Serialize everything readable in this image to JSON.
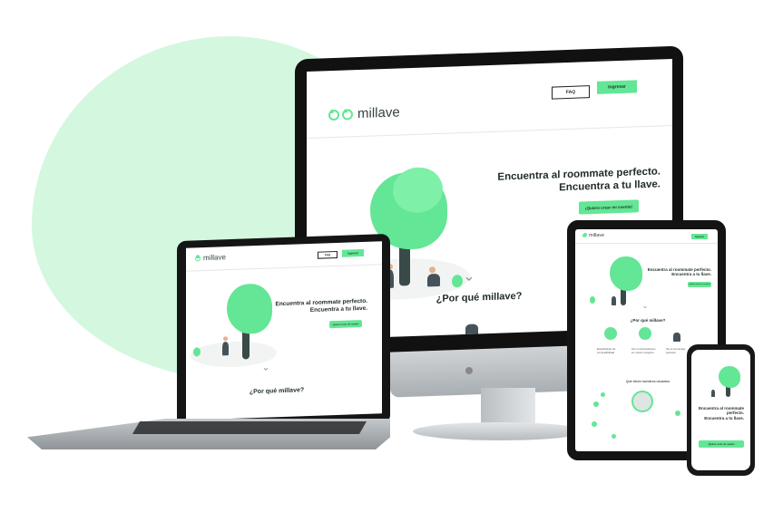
{
  "brand": {
    "name": "millave",
    "accent": "#63e695",
    "accent_bg": "#d4f7df"
  },
  "monitor": {
    "nav": {
      "faq_label": "FAQ",
      "login_label": "Ingresar"
    },
    "hero": {
      "line1": "Encuentra al roommate perfecto.",
      "line2": "Encuentra a tu llave.",
      "cta": "¡Quiero crear mi cuenta!"
    },
    "why_title": "¿Por qué millave?"
  },
  "laptop": {
    "nav": {
      "faq_label": "FAQ",
      "login_label": "Ingresar"
    },
    "hero": {
      "line1": "Encuentra al roommate perfecto.",
      "line2": "Encuentra a tu llave.",
      "cta": "¡Quiero crear mi cuenta!"
    },
    "why_title": "¿Por qué millave?"
  },
  "tablet": {
    "nav": {
      "login_label": "Ingresar"
    },
    "hero": {
      "line1": "Encuentra al roommate perfecto.",
      "line2": "Encuentra a tu llave.",
      "cta": "¡Quiero crear mi cuenta!"
    },
    "why_title": "¿Por qué millave?",
    "features": [
      "Estadísticas de compatibilidad",
      "Ten conversaciones en modo incógnito",
      "Sé el roommate perfecto"
    ],
    "testimonials_title": "Qué dicen nuestros usuarios"
  },
  "phone": {
    "hero": {
      "line1": "Encuentra al roommate perfecto.",
      "line2": "Encuentra a tu llave.",
      "cta": "¡Quiero crear mi cuenta!"
    }
  }
}
